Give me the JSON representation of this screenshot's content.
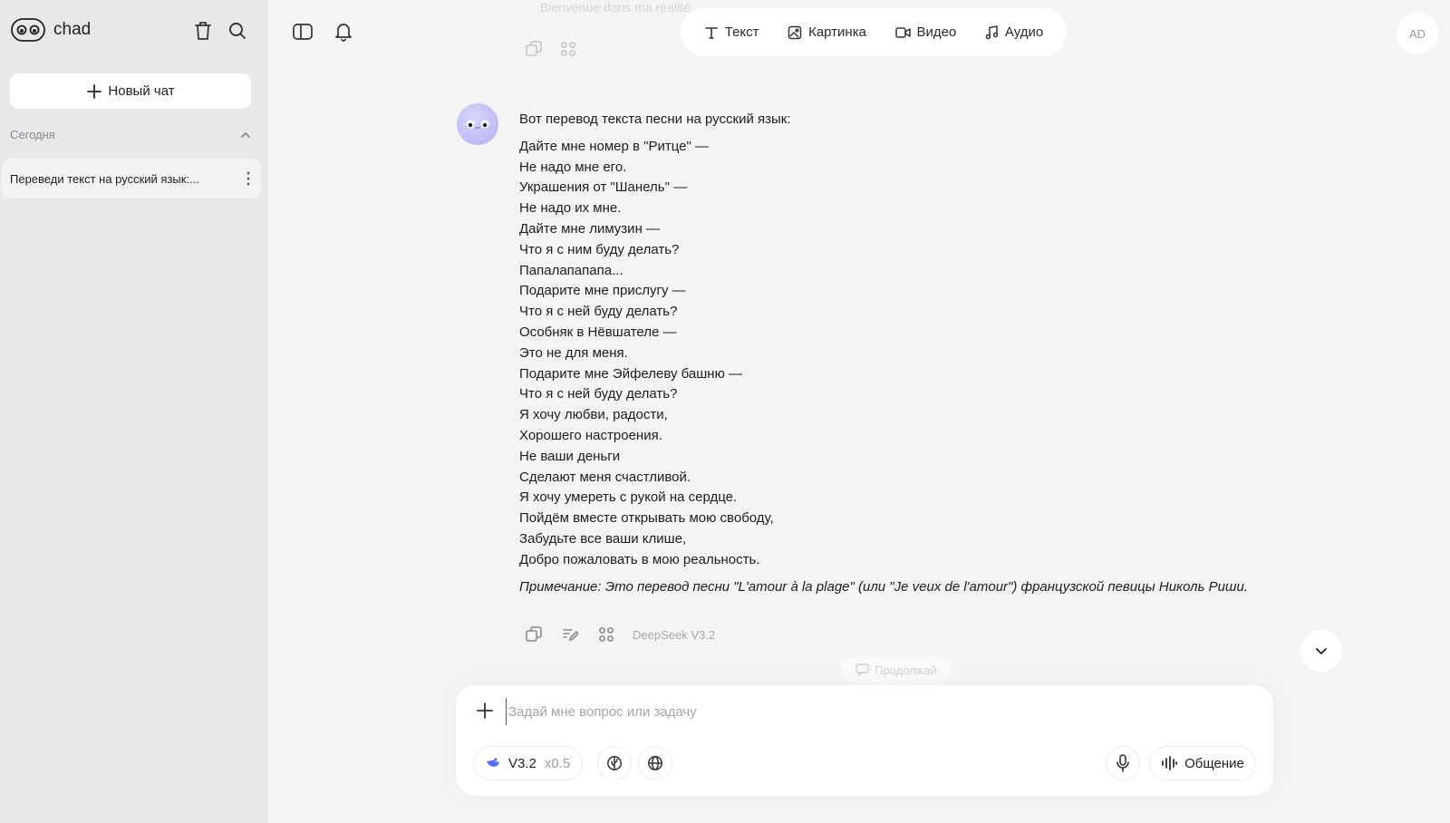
{
  "sidebar": {
    "brand": "chad",
    "new_chat": "Новый чат",
    "section": "Сегодня",
    "chats": [
      {
        "title": "Переведи текст на русский язык:..."
      }
    ]
  },
  "top": {
    "modes": [
      "Текст",
      "Картинка",
      "Видео",
      "Аудио"
    ],
    "user_initials": "AD"
  },
  "previous_message": {
    "text": "Bienvenue dans ma réalité"
  },
  "message": {
    "intro": "Вот перевод текста песни на русский язык:",
    "lines": [
      "Дайте мне номер в \"Ритце\" —",
      "Не надо мне его.",
      "Украшения от \"Шанель\" —",
      "Не надо их мне.",
      "Дайте мне лимузин —",
      "Что я с ним буду делать?",
      "Папалапапапа...",
      "Подарите мне прислугу —",
      "Что я с ней буду делать?",
      "Особняк в Нёвшателе —",
      "Это не для меня.",
      "Подарите мне Эйфелеву башню —",
      "Что я с ней буду делать?",
      "Я хочу любви, радости,",
      "Хорошего настроения.",
      "Не ваши деньги",
      "Сделают меня счастливой.",
      "Я хочу умереть с рукой на сердце.",
      "Пойдём вместе открывать мою свободу,",
      "Забудьте все ваши клише,",
      "Добро пожаловать в мою реальность."
    ],
    "note": "Примечание: Это перевод песни \"L'amour à la plage\" (или \"Je veux de l'amour\") французской певицы Николь Риши.",
    "model": "DeepSeek V3.2"
  },
  "continue_chip": "Продолжай",
  "composer": {
    "placeholder": "Задай мне вопрос или задачу",
    "model_version": "V3.2",
    "multiplier": "x0.5",
    "talk_label": "Общение"
  },
  "colors": {
    "sidebar_bg": "#e8e8ea",
    "main_bg": "#f4f4f4",
    "avatar": "#c5c3f7"
  }
}
